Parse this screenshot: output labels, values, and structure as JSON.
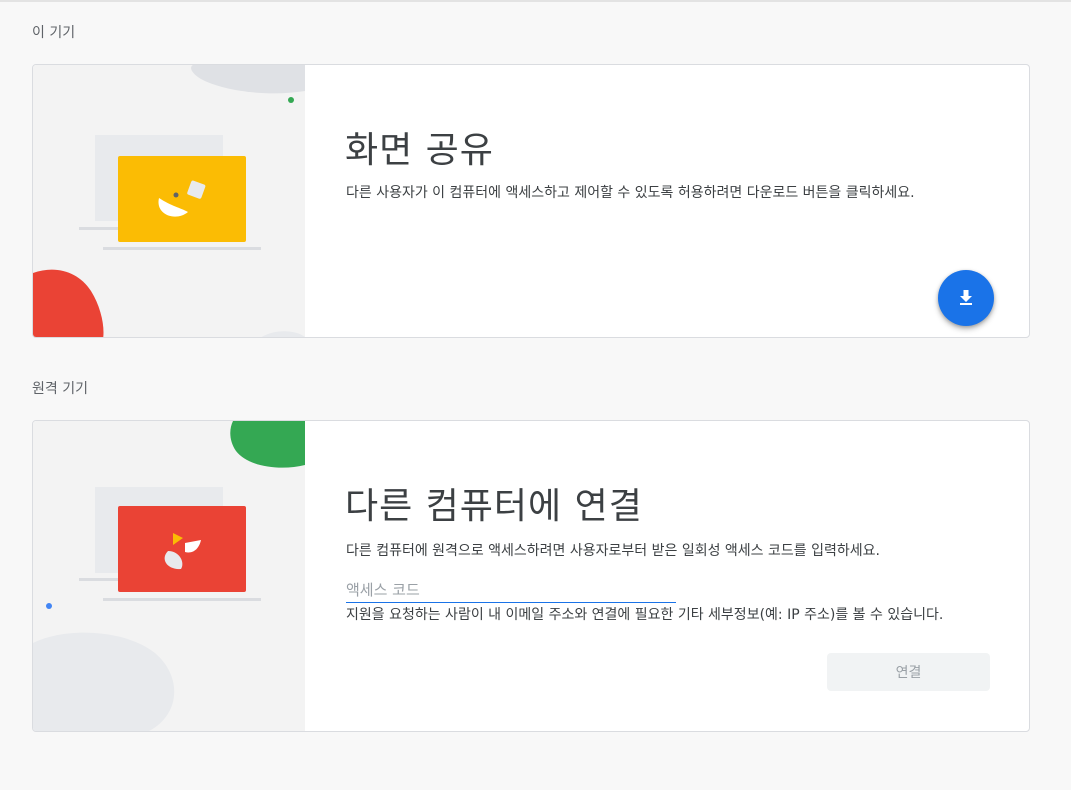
{
  "this_device": {
    "section_label": "이 기기",
    "title": "화면 공유",
    "description": "다른 사용자가 이 컴퓨터에 액세스하고 제어할 수 있도록 허용하려면 다운로드 버튼을 클릭하세요.",
    "download_icon": "download-icon"
  },
  "remote_device": {
    "section_label": "원격 기기",
    "title": "다른 컴퓨터에 연결",
    "description": "다른 컴퓨터에 원격으로 액세스하려면 사용자로부터 받은 일회성 액세스 코드를 입력하세요.",
    "access_code": {
      "value": "",
      "placeholder": "액세스 코드"
    },
    "hint": "지원을 요청하는 사람이 내 이메일 주소와 연결에 필요한 기타 세부정보(예: IP 주소)를 볼 수 있습니다.",
    "connect_label": "연결"
  },
  "colors": {
    "accent": "#1a73e8",
    "yellow": "#fbbc04",
    "red": "#ea4335",
    "green": "#34a853"
  }
}
